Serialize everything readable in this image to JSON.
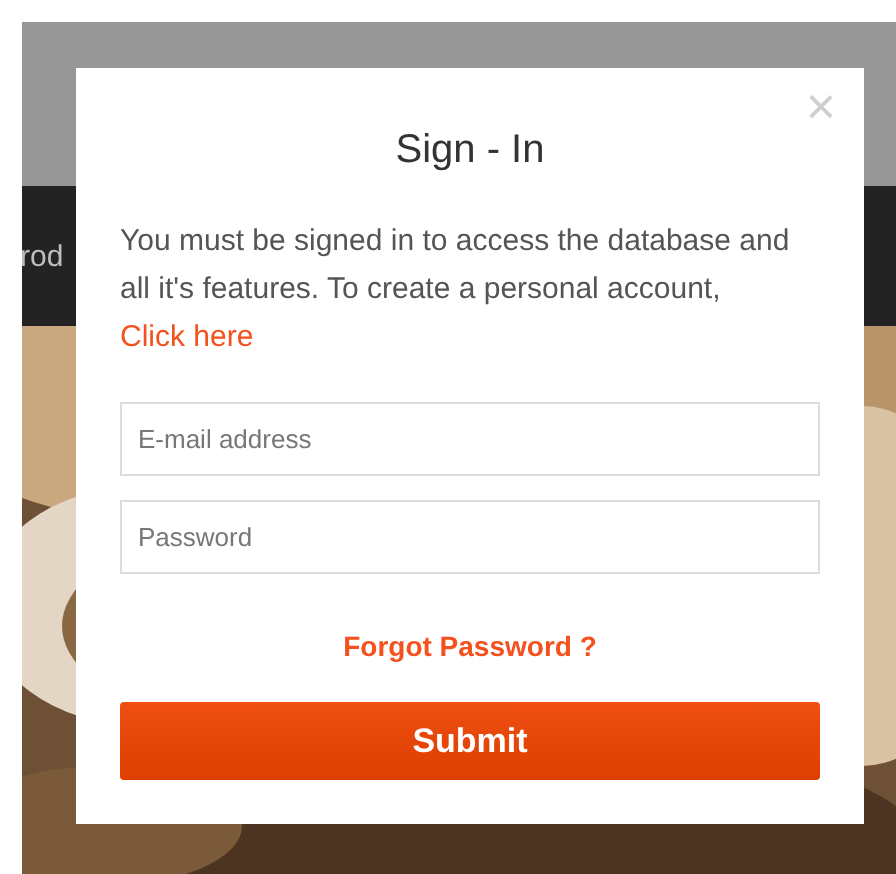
{
  "background": {
    "nav_text": "rod"
  },
  "modal": {
    "close": "×",
    "title": "Sign - In",
    "message": "You must be signed in to access the database and all it's features. To create a personal account,",
    "link": "Click here",
    "fields": [
      {
        "placeholder": "E-mail address"
      },
      {
        "placeholder": "Password"
      }
    ],
    "forgot": "Forgot Password ?",
    "submit": "Submit"
  }
}
